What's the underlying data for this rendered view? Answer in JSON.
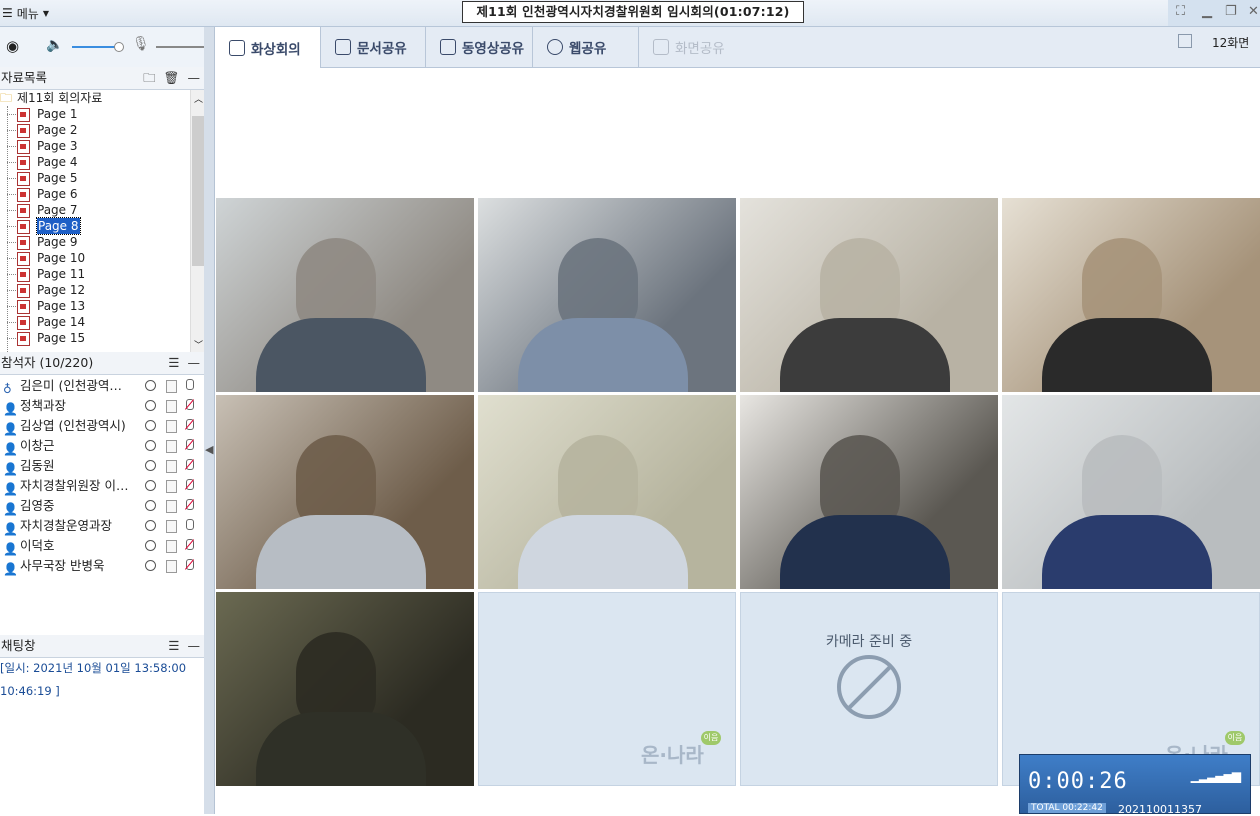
{
  "app": {
    "menu_label": "메뉴",
    "title": "제11회 인천광역시자치경찰위원회 임시회의(01:07:12)"
  },
  "tabs": [
    {
      "label": "화상회의",
      "icon": "person-icon",
      "active": true
    },
    {
      "label": "문서공유",
      "icon": "document-icon"
    },
    {
      "label": "동영상공유",
      "icon": "play-icon"
    },
    {
      "label": "웹공유",
      "icon": "globe-icon"
    },
    {
      "label": "화면공유",
      "icon": "screen-icon",
      "disabled": true
    }
  ],
  "layout_label": "12화면",
  "materials": {
    "title": "자료목록",
    "folder": "제11회 회의자료",
    "pages": [
      "Page 1",
      "Page 2",
      "Page 3",
      "Page 4",
      "Page 5",
      "Page 6",
      "Page 7",
      "Page 8",
      "Page 9",
      "Page 10",
      "Page 11",
      "Page 12",
      "Page 13",
      "Page 14",
      "Page 15"
    ],
    "selected_page": "Page 8"
  },
  "participants": {
    "title": "참석자 (10/220)",
    "list": [
      {
        "name": "김은미 (인천광역…",
        "host": true,
        "mic_muted": false
      },
      {
        "name": "정책과장",
        "mic_muted": true
      },
      {
        "name": "김상엽 (인천광역시)",
        "mic_muted": true
      },
      {
        "name": "이창근",
        "mic_muted": true
      },
      {
        "name": "김동원",
        "mic_muted": true
      },
      {
        "name": "자치경찰위원장 이…",
        "mic_muted": true
      },
      {
        "name": "김영중",
        "mic_muted": true
      },
      {
        "name": "자치경찰운영과장",
        "mic_muted": false
      },
      {
        "name": "이덕호",
        "mic_muted": true
      },
      {
        "name": "사무국장 반병욱",
        "mic_muted": true
      }
    ]
  },
  "chat": {
    "title": "채팅창",
    "line1": "[일시: 2021년 10월 01일 13:58:00",
    "line2": "10:46:19 ]"
  },
  "video": {
    "camera_ready_text": "카메라 준비 중",
    "logo_text": "온·나라",
    "logo_badge": "이음"
  },
  "timer": {
    "elapsed": "0:00:26",
    "total": "TOTAL 00:22:42",
    "code": "202110011357"
  },
  "colors": {
    "tab_bar": "#e4ebf4",
    "selected": "#1e5fc6",
    "empty_cell": "#dbe6f1",
    "timer_bg": "#3f7ec8"
  }
}
